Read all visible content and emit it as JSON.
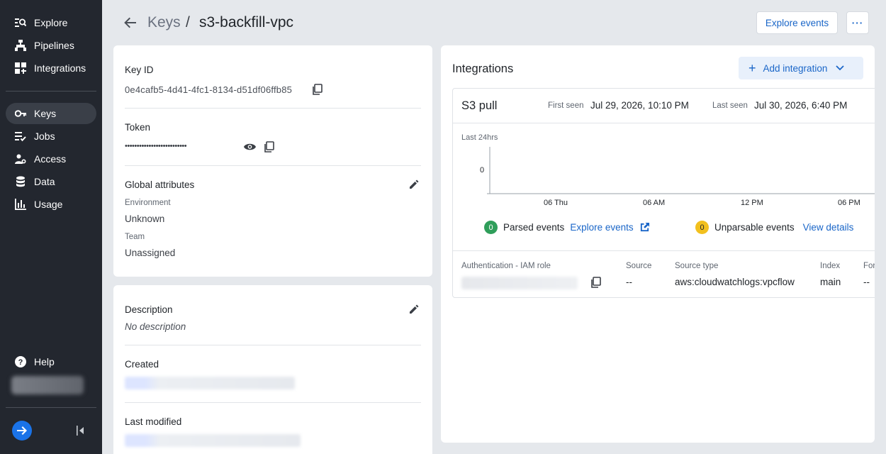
{
  "sidebar": {
    "items": [
      {
        "label": "Explore",
        "icon": "search-list-icon"
      },
      {
        "label": "Pipelines",
        "icon": "pipeline-icon"
      },
      {
        "label": "Integrations",
        "icon": "grid-icon"
      },
      {
        "label": "Keys",
        "icon": "key-icon",
        "active": true
      },
      {
        "label": "Jobs",
        "icon": "jobs-icon"
      },
      {
        "label": "Access",
        "icon": "access-icon"
      },
      {
        "label": "Data",
        "icon": "database-icon"
      },
      {
        "label": "Usage",
        "icon": "bar-chart-icon"
      }
    ],
    "help_label": "Help"
  },
  "header": {
    "crumb_parent": "Keys",
    "crumb_sep": "/",
    "title": "s3-backfill-vpc",
    "explore_events": "Explore events",
    "more": "···"
  },
  "key_card": {
    "key_id_label": "Key ID",
    "key_id": "0e4cafb5-4d41-4fc1-8134-d51df06ffb85",
    "token_label": "Token",
    "token_masked": "••••••••••••••••••••••••••",
    "global_attributes_label": "Global attributes",
    "environment_label": "Environment",
    "environment_value": "Unknown",
    "team_label": "Team",
    "team_value": "Unassigned"
  },
  "desc_card": {
    "description_label": "Description",
    "description_value": "No description",
    "created_label": "Created",
    "last_modified_label": "Last modified"
  },
  "integrations": {
    "title": "Integrations",
    "add_label": "Add integration",
    "item": {
      "name": "S3 pull",
      "first_seen_label": "First seen",
      "first_seen": "Jul 29, 2026, 10:10 PM",
      "last_seen_label": "Last seen",
      "last_seen": "Jul 30, 2026, 6:40 PM",
      "range_label": "Last 24hrs",
      "parsed_count": "0",
      "parsed_label": "Parsed events",
      "parsed_link": "Explore events",
      "unparsable_count": "0",
      "unparsable_label": "Unparsable events",
      "unparsable_link": "View details",
      "columns": [
        "Authentication - IAM role",
        "Source",
        "Source type",
        "Index",
        "For"
      ],
      "values": [
        "",
        "--",
        "aws:cloudwatchlogs:vpcflow",
        "main",
        "--"
      ]
    }
  },
  "colors": {
    "sidebar_bg": "#23272f",
    "accent": "#1a66c8",
    "parsed": "#2f9e5a",
    "unparsable": "#f2c01e"
  },
  "chart_data": {
    "type": "line",
    "title": "",
    "subtitle": "Last 24hrs",
    "x": [
      "06 Thu",
      "06 AM",
      "12 PM",
      "06 PM"
    ],
    "y_ticks": [
      "0"
    ],
    "series": [],
    "grid": false
  }
}
